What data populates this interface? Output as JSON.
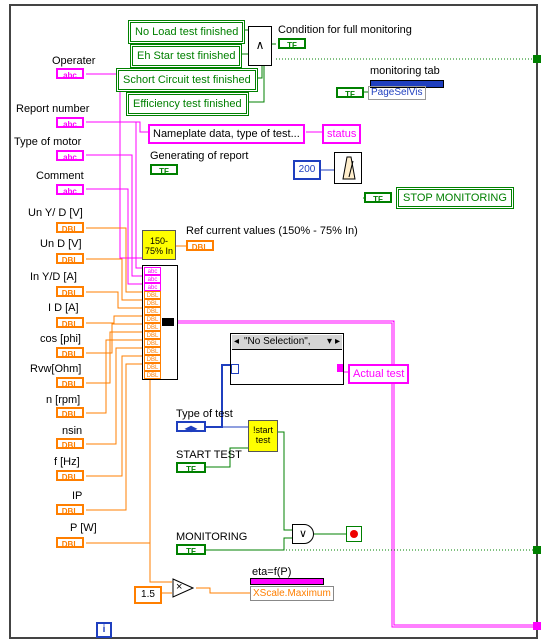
{
  "conditions": {
    "no_load": "No Load test finished",
    "eh_star": "Eh Star test finished",
    "short_circuit": "Schort Circuit test finished",
    "efficiency": "Efficiency test finished"
  },
  "condition_label": "Condition for full monitoring",
  "inputs": {
    "operator": "Operater",
    "report_number": "Report number",
    "type_of_motor": "Type of motor",
    "comment": "Comment",
    "un_yd": "Un Y/ D  [V]",
    "un_d": "Un D  [V]",
    "in_yd": "In Y/D  [A]",
    "i_d": "I D  [A]",
    "cos_phi": "cos [phi]",
    "rvw": "Rvw[Ohm]",
    "n_rpm": "n  [rpm]",
    "nsin": "nsin",
    "f_hz": "f [Hz]",
    "ip": "IP",
    "p_w": "P  [W]"
  },
  "types": {
    "str": "abc",
    "dbl": "DBL",
    "bool": "TF",
    "enum": "◀▶"
  },
  "monitoring_tab": "monitoring tab",
  "page_sel_vis": "PageSelVis",
  "nameplate": "Nameplate data, type of test...",
  "status": "status",
  "generating_label": "Generating of report",
  "wait_value": "200",
  "stop_monitoring": "STOP MONITORING",
  "ref_block": "150-75% In",
  "ref_label": "Ref current values (150% - 75% In)",
  "selector_value": "\"No Selection\",",
  "actual_test": "Actual test",
  "type_of_test": "Type of test",
  "start_test_block": "!start test",
  "start_test_label": "START TEST",
  "monitoring_label": "MONITORING",
  "eta_label": "eta=f(P)",
  "xscale": "XScale.Maximum",
  "const_15": "1.5",
  "info_icon": "i",
  "and_symbol": "∧",
  "or_symbol": "∨",
  "mult_symbol": "×"
}
